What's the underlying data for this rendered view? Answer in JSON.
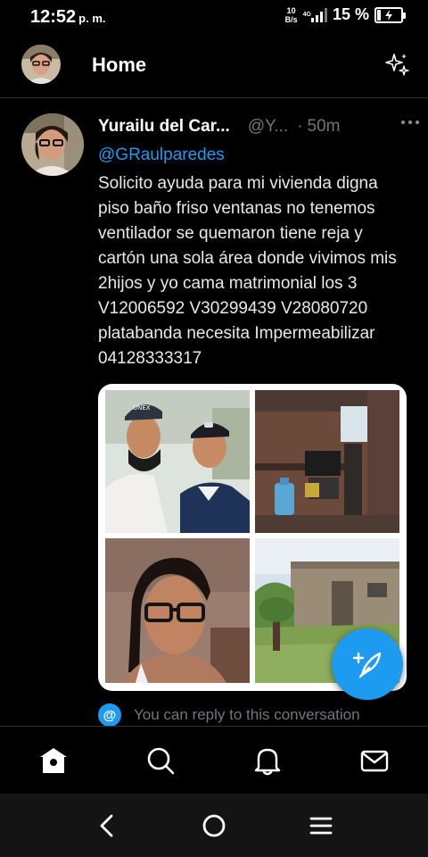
{
  "status_bar": {
    "time": "12:52",
    "ampm": "p. m.",
    "net_speed_value": "10",
    "net_speed_unit": "B/s",
    "net_type": "4G",
    "battery_percent": "15 %",
    "battery_level": 0.15
  },
  "header": {
    "title": "Home"
  },
  "tweet": {
    "display_name": "Yurailu del Car...",
    "handle": "@Y...",
    "separator": "·",
    "time": "50m",
    "mention": "@GRaulparedes",
    "text": "Solicito ayuda para mi vivienda digna piso baño friso ventanas no tenemos ventilador se quemaron tiene reja y cartón una sola área donde vivimos mis  2hijos y yo cama matrimonial los 3 V12006592 V30299439 V28080720 platabanda necesita Impermeabilizar 04128333317",
    "photo_text": "UNEX"
  },
  "reply": {
    "icon_glyph": "@",
    "text": "You can reply to this conversation"
  },
  "colors": {
    "accent": "#1d9bf0",
    "background": "#000000",
    "secondary_text": "#71767b",
    "divider": "#2f3336"
  },
  "icons": {
    "sparkle": "sparkle-icon",
    "compose": "compose-feather-icon",
    "home": "home-icon",
    "search": "search-icon",
    "notifications": "bell-icon",
    "messages": "envelope-icon",
    "back": "back-icon",
    "home_system": "circle-home-icon",
    "recents": "menu-lines-icon"
  }
}
